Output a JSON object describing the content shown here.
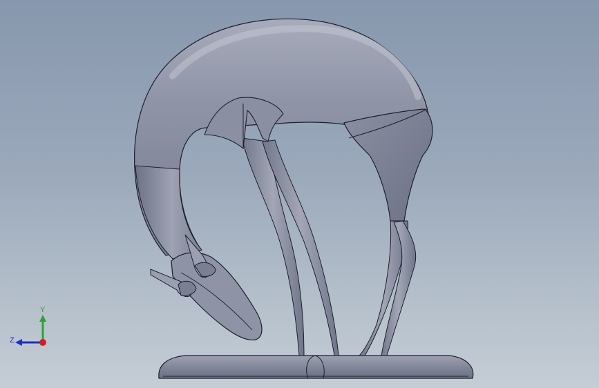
{
  "viewport": {
    "background_top": "#8797ad",
    "background_bottom": "#c5cdd5"
  },
  "model": {
    "subject": "gazelle-sculpture",
    "body_color": "#8e93a6",
    "highlight_color": "#b9bcc9",
    "shadow_color": "#5f6477",
    "edge_color": "#1d1f2a"
  },
  "triad": {
    "y_label": "Y",
    "z_label": "Z",
    "y_color": "#2fa12f",
    "z_color": "#1f2fbf",
    "x_color": "#d11f1f"
  }
}
